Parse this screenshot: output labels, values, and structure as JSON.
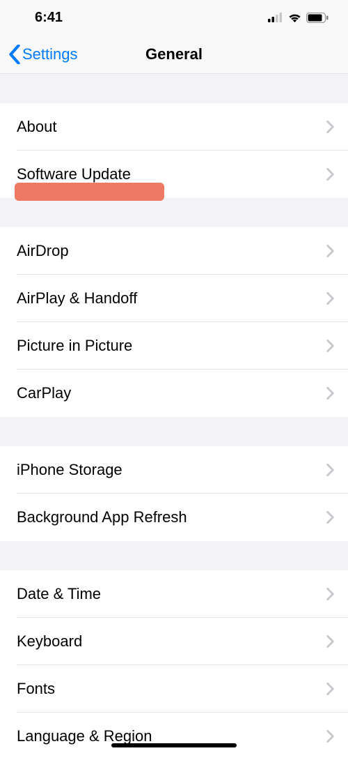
{
  "statusBar": {
    "time": "6:41"
  },
  "nav": {
    "back": "Settings",
    "title": "General"
  },
  "sections": [
    {
      "items": [
        {
          "label": "About"
        },
        {
          "label": "Software Update"
        }
      ]
    },
    {
      "items": [
        {
          "label": "AirDrop"
        },
        {
          "label": "AirPlay & Handoff"
        },
        {
          "label": "Picture in Picture"
        },
        {
          "label": "CarPlay"
        }
      ]
    },
    {
      "items": [
        {
          "label": "iPhone Storage"
        },
        {
          "label": "Background App Refresh"
        }
      ]
    },
    {
      "items": [
        {
          "label": "Date & Time"
        },
        {
          "label": "Keyboard"
        },
        {
          "label": "Fonts"
        },
        {
          "label": "Language & Region"
        }
      ]
    }
  ]
}
